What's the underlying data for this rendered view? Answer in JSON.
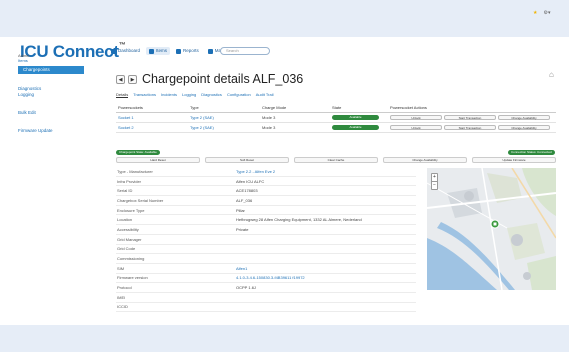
{
  "header": {
    "brand": "ICU Connect",
    "trademark": "™",
    "nav": [
      {
        "label": "Dashboard",
        "icon": "dashboard-icon",
        "active": false
      },
      {
        "label": "Items",
        "icon": "items-icon",
        "active": true
      },
      {
        "label": "Reports",
        "icon": "reports-icon",
        "active": false
      },
      {
        "label": "Maintenance",
        "icon": "wrench-icon",
        "active": false
      }
    ],
    "search_placeholder": "Search",
    "right_icons": [
      "star-icon",
      "gear-icon"
    ]
  },
  "sidebar": {
    "user": "Admin",
    "role": "Items",
    "active_item": "Chargepoints",
    "links": [
      "Diagnostics",
      "Logging",
      "Bulk Edit",
      "Firmware Update"
    ]
  },
  "page": {
    "title": "Chargepoint details ALF_036",
    "back_symbol": "◀",
    "forward_symbol": "▶",
    "tabs": [
      "Details",
      "Transactions",
      "Incidents",
      "Logging",
      "Diagnostics",
      "Configuration",
      "Audit Trail"
    ],
    "active_tab": "Details"
  },
  "connectors": {
    "headers": [
      "Powersockets",
      "Type",
      "Charge Mode",
      "State",
      "Powersocket Actions"
    ],
    "rows": [
      {
        "name": "Socket 1",
        "type": "Type 2 (SAE)",
        "mode": "Mode 3",
        "state": "Available",
        "actions": [
          "Unlock",
          "Start Transaction",
          "Change Availability"
        ]
      },
      {
        "name": "Socket 2",
        "type": "Type 2 (SAE)",
        "mode": "Mode 3",
        "state": "Available",
        "actions": [
          "Unlock",
          "Start Transaction",
          "Change Availability"
        ]
      }
    ]
  },
  "status": {
    "chargepoint_state": "Chargepoint State: Available",
    "connection": "Connection Status: Connected"
  },
  "actions": [
    "Hard Reset",
    "Soft Reset",
    "Clear Cache",
    "Change Availability",
    "Update Firmware"
  ],
  "details": [
    {
      "label": "Type - Manufacturer",
      "value": "Type 2.2 - Alfen Eve 2",
      "link": true
    },
    {
      "label": "Infra Provider",
      "value": "Alfen ICU ALFC",
      "link": false
    },
    {
      "label": "Serial ID",
      "value": "ACE178803",
      "link": false
    },
    {
      "label": "Chargebox Serial Number",
      "value": "ALF_036",
      "link": false
    },
    {
      "label": "Enclosure Type",
      "value": "Pillar",
      "link": false
    },
    {
      "label": "Location",
      "value": "Hefbrugweg 28 Alfen Charging Equipment, 1332 AL Almere, Nederland",
      "link": false
    },
    {
      "label": "Accessibility",
      "value": "Private",
      "link": false
    },
    {
      "label": "Grid Manager",
      "value": "",
      "link": false
    },
    {
      "label": "Grid Code",
      "value": "",
      "link": false
    },
    {
      "label": "Commissioning",
      "value": "",
      "link": false
    },
    {
      "label": "SIM",
      "value": "Alfen1",
      "link": true
    },
    {
      "label": "Firmware version",
      "value": "4.1.0-3.4.6-150830.3-f4B39611 f19972",
      "link": true
    },
    {
      "label": "Protocol",
      "value": "OCPP 1.6J",
      "link": false
    },
    {
      "label": "IMEI",
      "value": "",
      "link": false
    },
    {
      "label": "ICCID",
      "value": "",
      "link": false
    }
  ],
  "map": {
    "zoom_in": "+",
    "zoom_out": "−",
    "marker_color": "#3b9a3e",
    "water_color": "#9fc3e3",
    "land_color": "#d8e5cf"
  }
}
